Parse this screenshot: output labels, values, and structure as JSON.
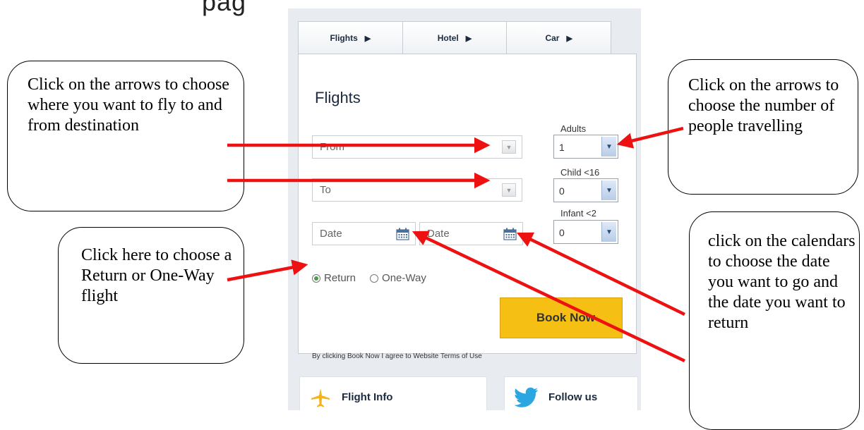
{
  "widget": {
    "tabs": [
      {
        "label": "Flights",
        "arrow": "▶"
      },
      {
        "label": "Hotel",
        "arrow": "▶"
      },
      {
        "label": "Car",
        "arrow": "▶"
      }
    ],
    "title": "Flights",
    "from_label": "From",
    "to_label": "To",
    "date_depart": "Date",
    "date_return": "Date",
    "adults_label": "Adults",
    "adults_value": "1",
    "child_label": "Child <16",
    "child_value": "0",
    "infant_label": "Infant <2",
    "infant_value": "0",
    "radio_return": "Return",
    "radio_oneway": "One-Way",
    "book_button": "Book Now",
    "terms": "By clicking Book Now I agree to Website Terms of Use",
    "flight_info": "Flight Info",
    "follow_us": "Follow us"
  },
  "callouts": {
    "destination": "Click on the arrows to choose where you want to fly to and from destination",
    "passengers": "Click on the arrows to choose the number of people travelling",
    "trip_type": "Click here to choose a Return or One-Way flight",
    "dates": "click on the calendars to choose the date you want to go and the date you want to return"
  },
  "colors": {
    "arrow": "#ee1111",
    "book_button": "#f5c013",
    "brand_icon": "#f3b51a",
    "twitter": "#2aa6e0"
  }
}
